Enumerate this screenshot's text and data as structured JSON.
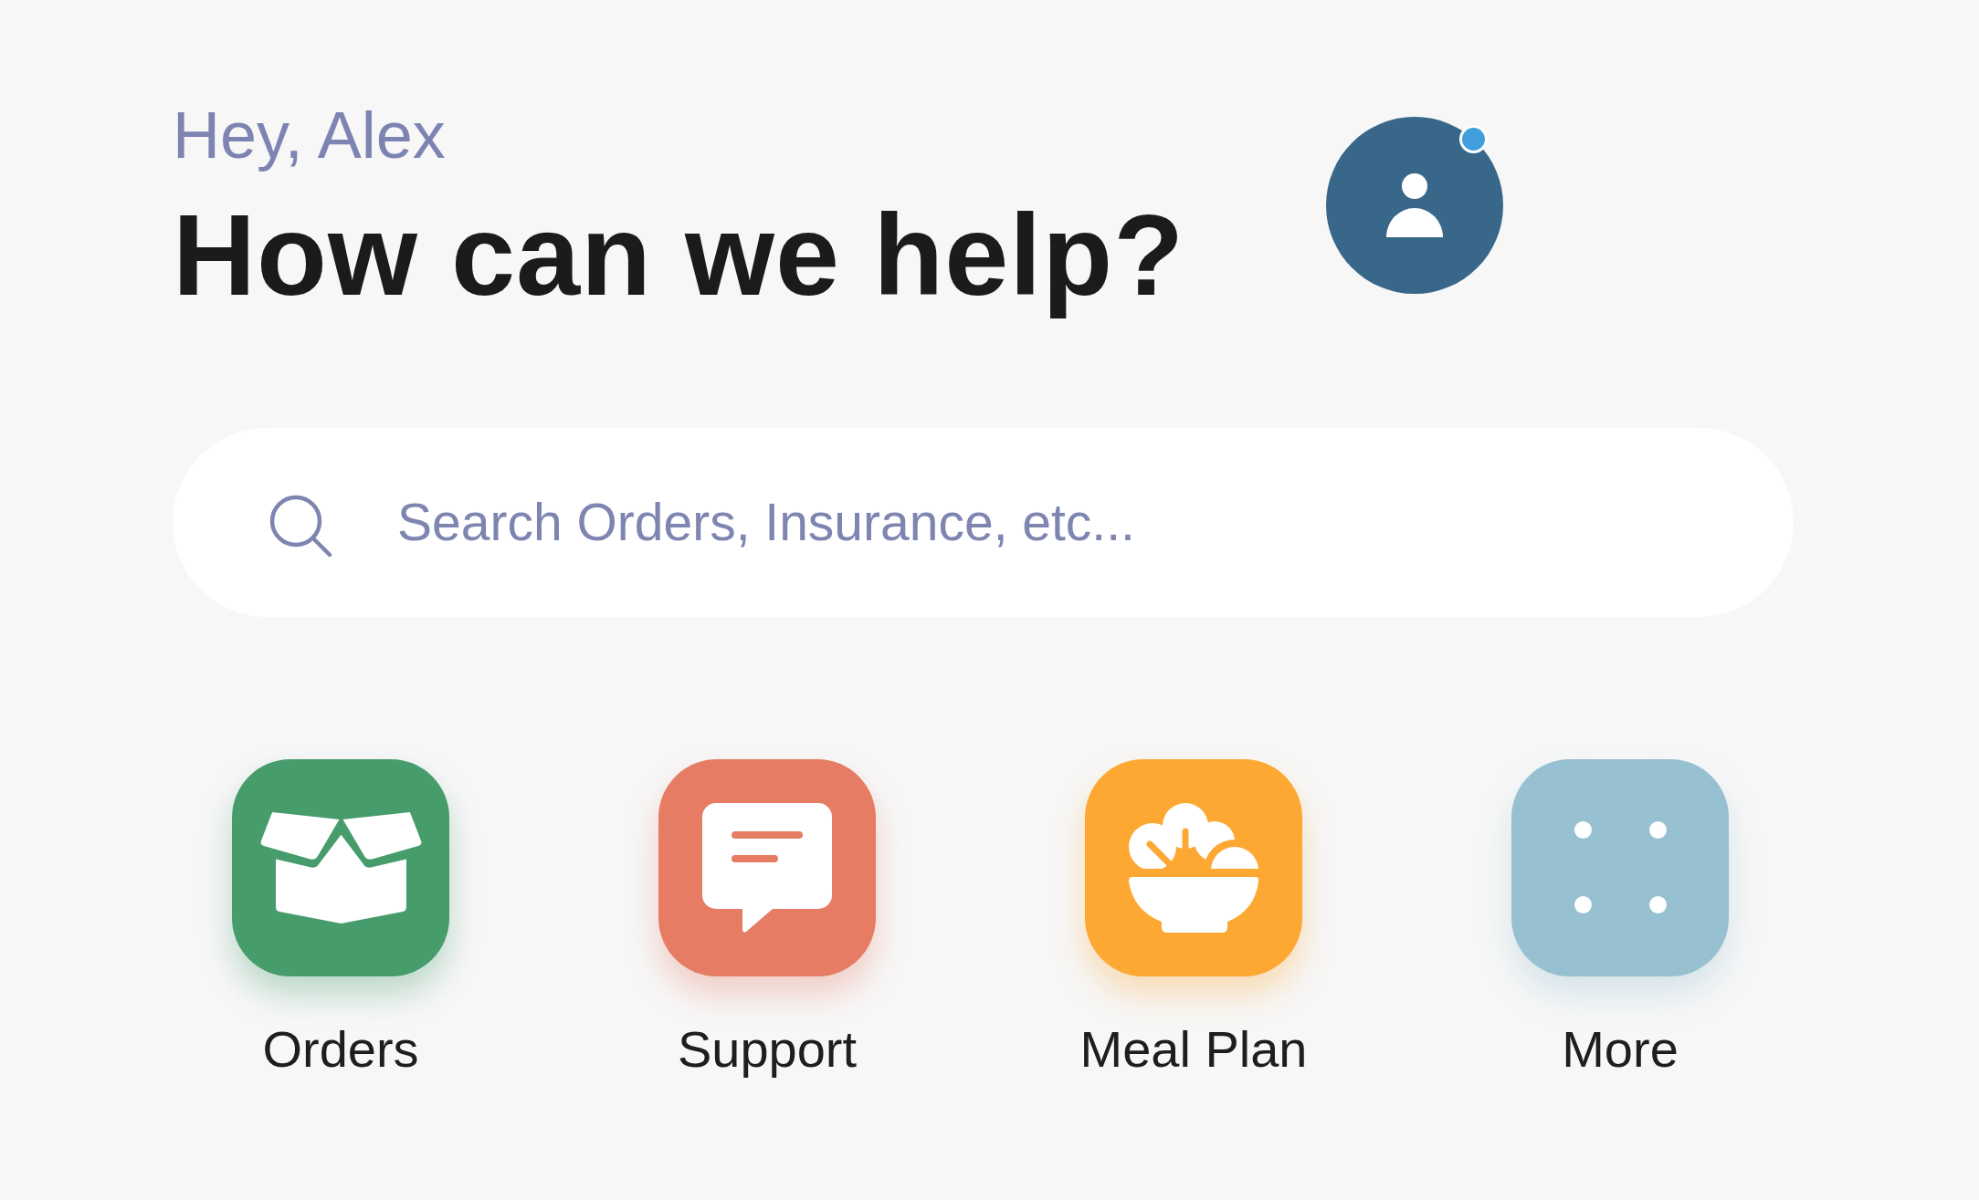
{
  "greeting": "Hey, Alex",
  "title": "How can we help?",
  "avatar": {
    "notification": true
  },
  "search": {
    "placeholder": "Search Orders, Insurance, etc..."
  },
  "shortcuts": [
    {
      "label": "Orders",
      "color": "#479c6c"
    },
    {
      "label": "Support",
      "color": "#e57c63"
    },
    {
      "label": "Meal Plan",
      "color": "#fca833"
    },
    {
      "label": "More",
      "color": "#97c0d0"
    }
  ]
}
